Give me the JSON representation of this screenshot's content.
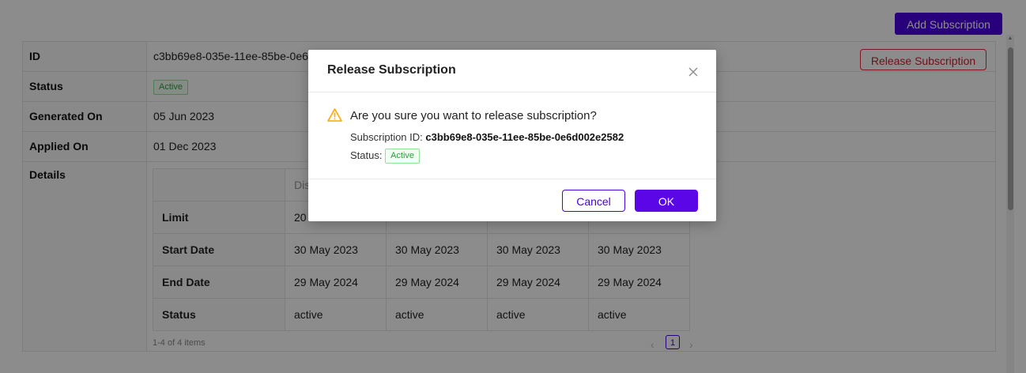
{
  "toolbar": {
    "add_subscription_label": "Add Subscription"
  },
  "subscription": {
    "id_label": "ID",
    "id_value": "c3bb69e8-035e-11ee-85be-0e6d002e2582",
    "status_label": "Status",
    "status_value": "Active",
    "generated_label": "Generated On",
    "generated_value": "05 Jun 2023",
    "applied_label": "Applied On",
    "applied_value": "01 Dec 2023",
    "details_label": "Details",
    "release_label": "Release Subscription"
  },
  "details": {
    "header_first": "Dis",
    "rows": [
      {
        "label": "Limit",
        "values": [
          "20",
          "",
          "",
          ""
        ]
      },
      {
        "label": "Start Date",
        "values": [
          "30 May 2023",
          "30 May 2023",
          "30 May 2023",
          "30 May 2023"
        ]
      },
      {
        "label": "End Date",
        "values": [
          "29 May 2024",
          "29 May 2024",
          "29 May 2024",
          "29 May 2024"
        ]
      },
      {
        "label": "Status",
        "values": [
          "active",
          "active",
          "active",
          "active"
        ]
      }
    ]
  },
  "pagination": {
    "summary": "1-4 of 4 items",
    "current_page": "1",
    "prev": "‹",
    "next": "›"
  },
  "modal": {
    "title": "Release Subscription",
    "question": "Are you sure you want to release subscription?",
    "sub_id_label": "Subscription ID: ",
    "sub_id_value": "c3bb69e8-035e-11ee-85be-0e6d002e2582",
    "status_label": "Status: ",
    "status_value": "Active",
    "cancel_label": "Cancel",
    "ok_label": "OK"
  },
  "colors": {
    "accent": "#4b00e0",
    "danger": "#e02d3f",
    "success": "#2f9e3f",
    "warning": "#faad14"
  },
  "icons": {
    "close": "close-icon",
    "warning": "warning-icon"
  }
}
